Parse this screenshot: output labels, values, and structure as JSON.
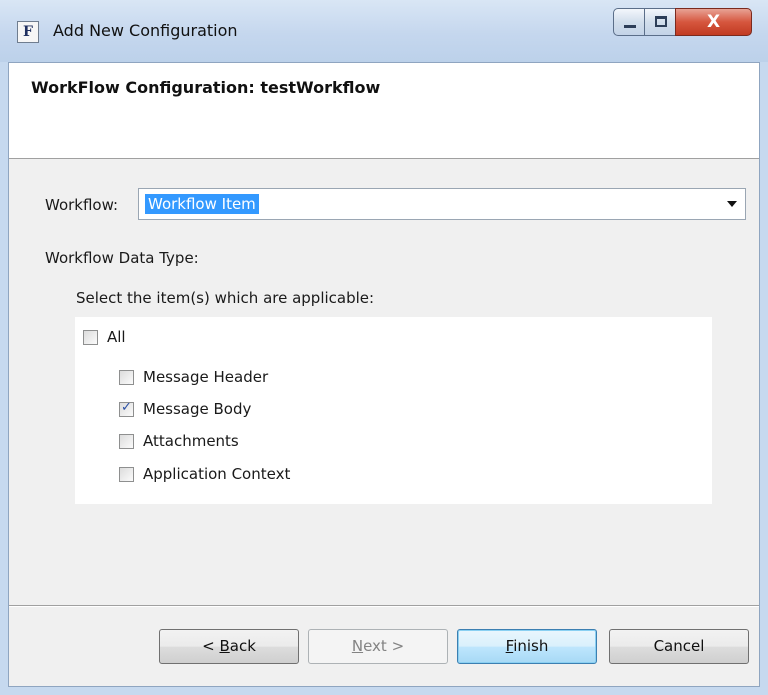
{
  "window": {
    "title": "Add New Configuration",
    "app_icon_letter": "F",
    "close_glyph": "X"
  },
  "header": {
    "title": "WorkFlow Configuration: testWorkflow"
  },
  "form": {
    "workflow_label": "Workflow:",
    "workflow_value": "Workflow Item",
    "data_type_label": "Workflow Data Type:",
    "select_label": "Select the item(s) which are applicable:",
    "items": [
      {
        "label": "All",
        "checked": false
      },
      {
        "label": "Message Header",
        "checked": false
      },
      {
        "label": "Message Body",
        "checked": true
      },
      {
        "label": "Attachments",
        "checked": false
      },
      {
        "label": "Application Context",
        "checked": false
      }
    ]
  },
  "buttons": {
    "back": {
      "prefix": "< ",
      "mnemonic": "B",
      "rest": "ack"
    },
    "next": {
      "mnemonic": "N",
      "rest": "ext >",
      "disabled": true
    },
    "finish": {
      "mnemonic": "F",
      "rest": "inish"
    },
    "cancel": {
      "label": "Cancel"
    }
  },
  "colors": {
    "selection": "#3399ff",
    "checkmark": "#2a4fa5",
    "close_button": "#c13b22"
  }
}
